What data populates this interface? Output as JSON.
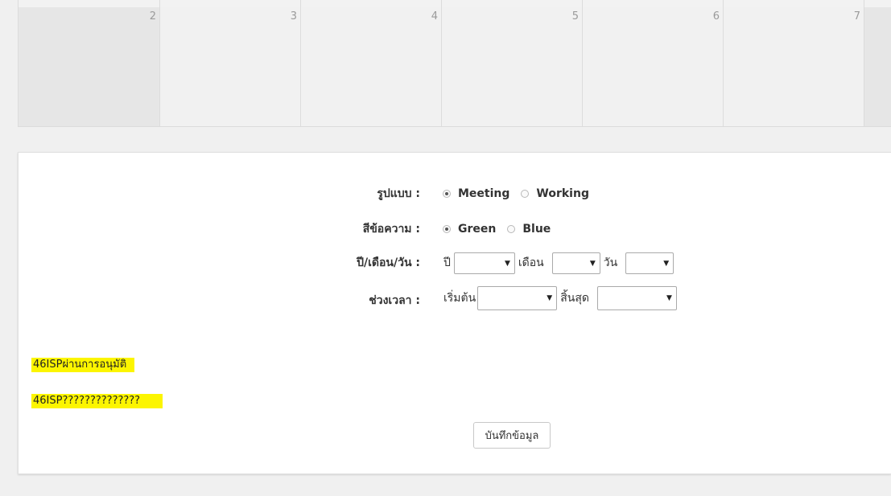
{
  "calendar": {
    "days": [
      "2",
      "3",
      "4",
      "5",
      "6",
      "7"
    ]
  },
  "form": {
    "type": {
      "label": "รูปแบบ :",
      "options": [
        "Meeting",
        "Working"
      ],
      "selected": "Meeting"
    },
    "color": {
      "label": "สีข้อความ :",
      "options": [
        "Green",
        "Blue"
      ],
      "selected": "Green"
    },
    "date": {
      "label": "ปี/เดือน/วัน :",
      "year_label": "ปี",
      "month_label": "เดือน",
      "day_label": "วัน",
      "year_value": "",
      "month_value": "",
      "day_value": ""
    },
    "time": {
      "label": "ช่วงเวลา :",
      "start_label": "เริ่มต้น",
      "end_label": "สิ้นสุด",
      "start_value": "",
      "end_value": ""
    },
    "highlights": [
      "46ISPผ่านการอนุมัติ",
      "46ISP??????????????"
    ],
    "save_label": "บันทึกข้อมูล"
  },
  "colors": {
    "highlight": "#fcf500",
    "panel_bg": "#ffffff",
    "page_bg": "#f0f0f0"
  }
}
